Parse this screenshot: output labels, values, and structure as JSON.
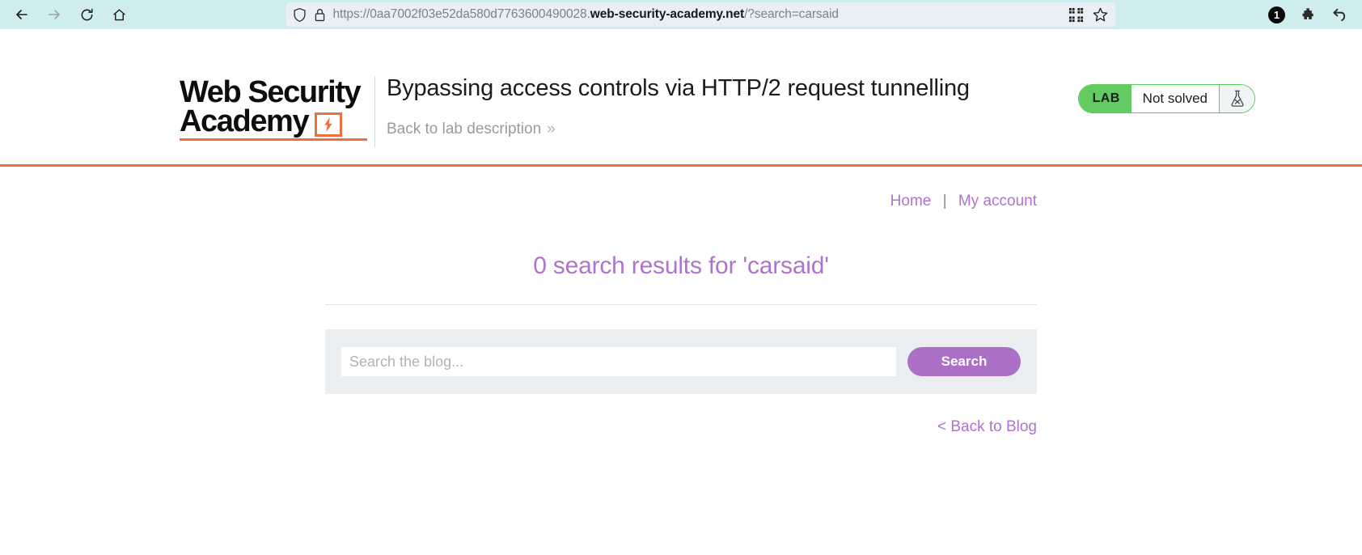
{
  "browser": {
    "nav": {
      "back_icon": "arrow-left-icon",
      "forward_icon": "arrow-right-icon",
      "reload_icon": "reload-icon",
      "home_icon": "home-icon"
    },
    "url": {
      "scheme": "https://",
      "subdomain": "0aa7002f03e52da580d7763600490028.",
      "host": "web-security-academy.net",
      "path": "/?search=carsaid",
      "full": "https://0aa7002f03e52da580d7763600490028.web-security-academy.net/?search=carsaid",
      "shield_icon": "shield-icon",
      "lock_icon": "lock-icon",
      "qr_icon": "qr-code-icon",
      "bookmark_icon": "star-icon"
    },
    "tools": {
      "notification_count": "1",
      "extension_icon": "puzzle-icon",
      "undo_icon": "undo-arrow-icon"
    }
  },
  "lab_header": {
    "logo_line1": "Web Security",
    "logo_line2": "Academy",
    "title": "Bypassing access controls via HTTP/2 request tunnelling",
    "back_to_description": "Back to lab description",
    "back_chevron": "»",
    "status": {
      "tag": "LAB",
      "state": "Not solved",
      "flask_icon": "flask-x-icon"
    }
  },
  "nav_links": {
    "home": "Home",
    "separator": "|",
    "my_account": "My account"
  },
  "main": {
    "results_heading": "0 search results for 'carsaid'",
    "search_placeholder": "Search the blog...",
    "search_value": "",
    "search_button": "Search",
    "back_to_blog": "< Back to Blog"
  },
  "colors": {
    "accent_orange": "#ec6f3d",
    "accent_purple": "#ab6fc6",
    "lab_green": "#62cb62",
    "panel_grey": "#eaeef0",
    "chrome_blue": "#cfecef"
  }
}
